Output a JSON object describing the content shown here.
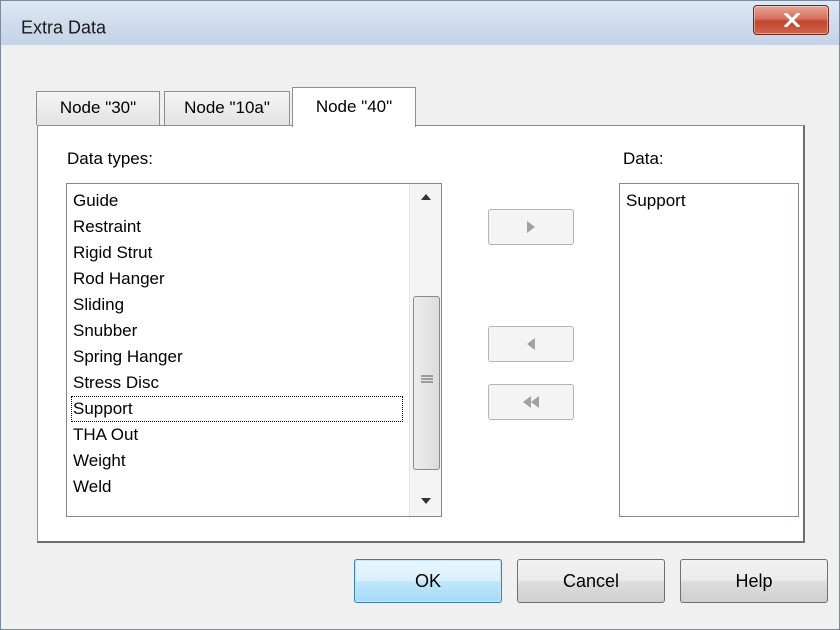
{
  "window": {
    "title": "Extra Data"
  },
  "tabs": [
    {
      "label": "Node \"30\"",
      "active": false
    },
    {
      "label": "Node \"10a\"",
      "active": false
    },
    {
      "label": "Node \"40\"",
      "active": true
    }
  ],
  "data_types": {
    "label": "Data types:",
    "items": [
      "Guide",
      "Restraint",
      "Rigid Strut",
      "Rod Hanger",
      "Sliding",
      "Snubber",
      "Spring Hanger",
      "Stress Disc",
      "Support",
      "THA Out",
      "Weight",
      "Weld"
    ],
    "focused_item": "Support"
  },
  "data": {
    "label": "Data:",
    "items": [
      "Support"
    ]
  },
  "move_buttons": {
    "add": "arrow-right-icon",
    "remove": "arrow-left-icon",
    "remove_all": "double-arrow-left-icon"
  },
  "buttons": {
    "ok": "OK",
    "cancel": "Cancel",
    "help": "Help"
  },
  "colors": {
    "close_button": "#c24530",
    "default_button": "#3c7fb1"
  }
}
